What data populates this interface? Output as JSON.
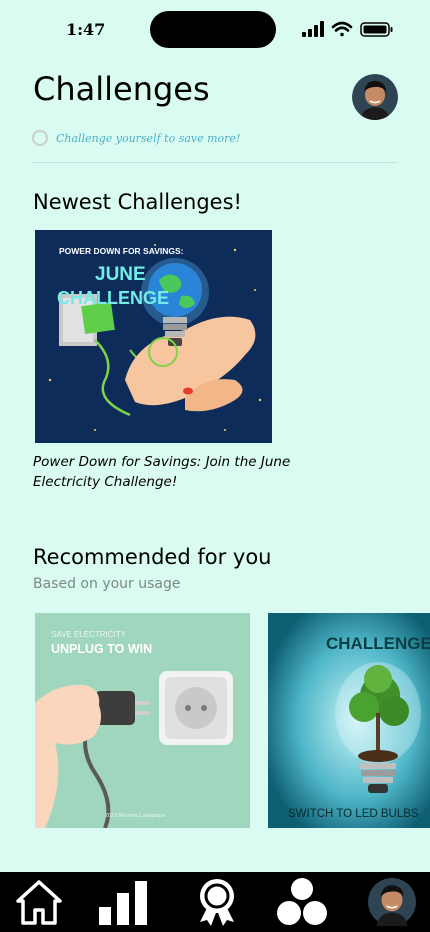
{
  "status_bar": {
    "time": "1:47"
  },
  "header": {
    "title": "Challenges",
    "subtitle": "Challenge yourself to save more!"
  },
  "newest": {
    "title": "Newest Challenges!",
    "card": {
      "image_top_text": "POWER DOWN FOR SAVINGS:",
      "image_headline_1": "JUNE",
      "image_headline_2": "CHALLENGE",
      "caption": "Power Down for Savings: Join the June Electricity Challenge!"
    }
  },
  "recommended": {
    "title": "Recommended for you",
    "subtitle": "Based on your usage",
    "cards": [
      {
        "small_text": "SAVE ELECTRICITY",
        "headline": "UNPLUG TO WIN",
        "credit": "2023 Minerva Laxeplatre"
      },
      {
        "headline": "CHALLENGE",
        "footer": "SWITCH TO LED BULBS"
      }
    ]
  },
  "nav": {
    "items": [
      "home-icon",
      "stats-icon",
      "award-icon",
      "community-icon",
      "profile-avatar"
    ]
  },
  "colors": {
    "background": "#d9fbf2",
    "nav_background": "#000000",
    "subtitle_accent": "#4fb0c8"
  }
}
